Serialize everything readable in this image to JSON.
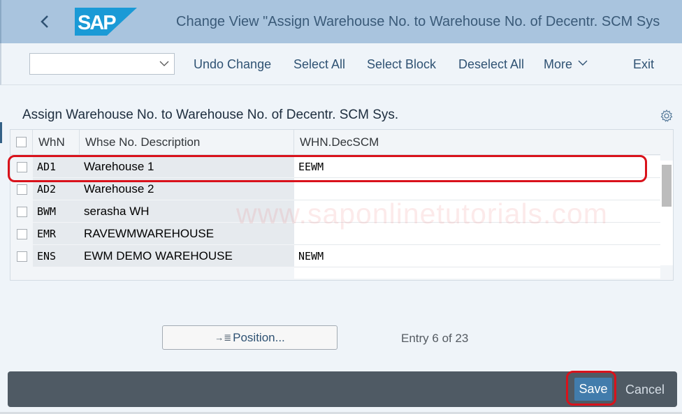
{
  "shell": {
    "title": "Change View \"Assign Warehouse No. to Warehouse No. of Decentr. SCM Sys",
    "logo_text": "SAP",
    "brand_color": "#1a9ad6"
  },
  "toolbar": {
    "dropdown_value": "",
    "buttons": [
      {
        "label": "Undo Change"
      },
      {
        "label": "Select All"
      },
      {
        "label": "Select Block"
      },
      {
        "label": "Deselect All"
      },
      {
        "label": "More"
      },
      {
        "label": "Exit"
      }
    ]
  },
  "section": {
    "title": "Assign Warehouse No. to Warehouse No. of Decentr. SCM Sys."
  },
  "table": {
    "columns": [
      "WhN",
      "Whse No. Description",
      "WHN.DecSCM"
    ],
    "rows": [
      {
        "whn": "AD1",
        "desc": "Warehouse 1",
        "dec": "EEWM",
        "highlighted": true
      },
      {
        "whn": "AD2",
        "desc": "Warehouse 2",
        "dec": ""
      },
      {
        "whn": "BWM",
        "desc": "serasha WH",
        "dec": ""
      },
      {
        "whn": "EMR",
        "desc": "RAVEWMWAREHOUSE",
        "dec": ""
      },
      {
        "whn": "ENS",
        "desc": "EWM DEMO WAREHOUSE",
        "dec": "NEWM"
      }
    ]
  },
  "watermark": "www.saponlinetutorials.com",
  "navigation": {
    "position_label": "Position...",
    "position_icon": "→≣",
    "entry_info": "Entry 6 of 23"
  },
  "footer": {
    "save_label": "Save",
    "cancel_label": "Cancel"
  },
  "colors": {
    "highlight": "#d9121b",
    "save_button": "#427cac"
  }
}
